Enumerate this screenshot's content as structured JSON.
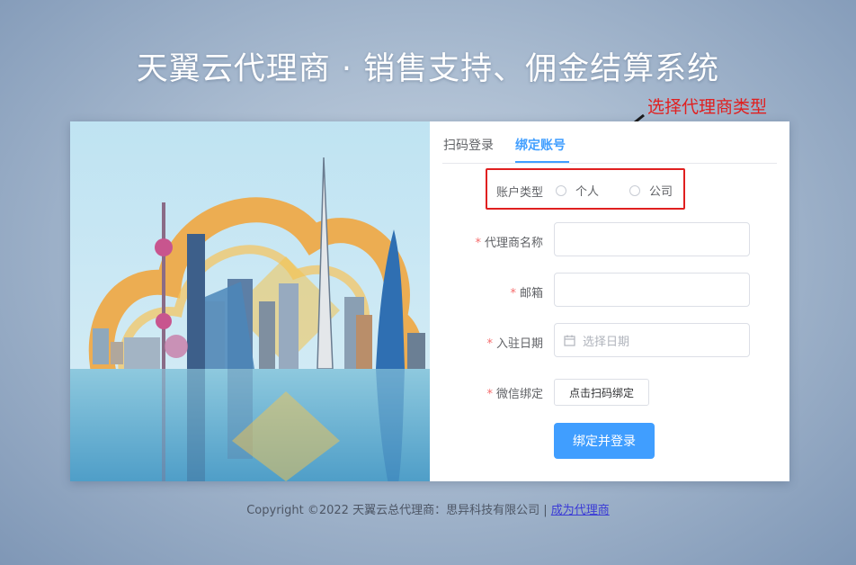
{
  "page": {
    "title": "天翼云代理商 · 销售支持、佣金结算系统",
    "annotation": "选择代理商类型"
  },
  "tabs": [
    {
      "label": "扫码登录",
      "active": false
    },
    {
      "label": "绑定账号",
      "active": true
    }
  ],
  "form": {
    "account_type": {
      "label": "账户类型",
      "options": [
        "个人",
        "公司"
      ]
    },
    "agent_name": {
      "label": "代理商名称",
      "required": true,
      "value": ""
    },
    "email": {
      "label": "邮箱",
      "required": true,
      "value": ""
    },
    "join_date": {
      "label": "入驻日期",
      "required": true,
      "placeholder": "选择日期",
      "icon": "calendar-icon"
    },
    "wechat": {
      "label": "微信绑定",
      "required": true,
      "button_label": "点击扫码绑定"
    },
    "submit_label": "绑定并登录"
  },
  "footer": {
    "copyright": "Copyright ©2022 天翼云总代理商：思异科技有限公司 |",
    "link": "成为代理商"
  },
  "colors": {
    "accent": "#409eff",
    "annotation": "#e02020",
    "required": "#f56c6c"
  }
}
